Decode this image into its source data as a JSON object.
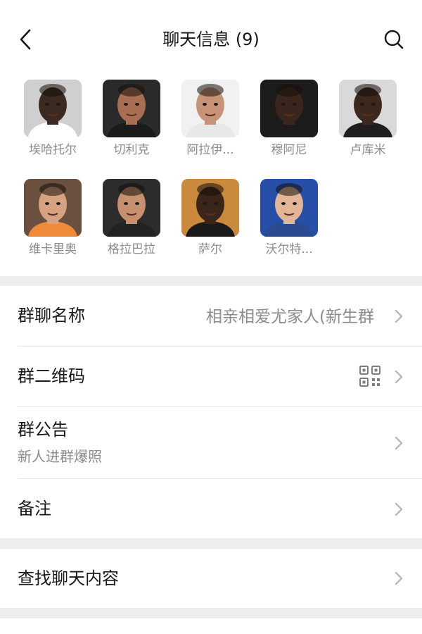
{
  "header": {
    "title": "聊天信息 (9)",
    "back_icon": "chevron-left-icon",
    "search_icon": "search-icon"
  },
  "members": [
    {
      "name": "埃哈托尔",
      "skin": "#3b2a22",
      "bg": "#cfcfcf",
      "shirt": "#ffffff"
    },
    {
      "name": "切利克",
      "skin": "#a86f52",
      "bg": "#2a2a2a",
      "shirt": "#1b1b1b"
    },
    {
      "name": "阿拉伊...",
      "skin": "#c79378",
      "bg": "#f1f1f1",
      "shirt": "#e8e8e8"
    },
    {
      "name": "穆阿尼",
      "skin": "#3a261d",
      "bg": "#1c1c1c",
      "shirt": "#1c1c1c"
    },
    {
      "name": "卢库米",
      "skin": "#3d281e",
      "bg": "#d9d9d9",
      "shirt": "#1e1e1e"
    },
    {
      "name": "维卡里奥",
      "skin": "#d7a27f",
      "bg": "#6b5040",
      "shirt": "#f08a3b"
    },
    {
      "name": "格拉巴拉",
      "skin": "#c68f6d",
      "bg": "#2c2c2c",
      "shirt": "#222222"
    },
    {
      "name": "萨尔",
      "skin": "#3b2519",
      "bg": "#c98a3d",
      "shirt": "#1a1a1a"
    },
    {
      "name": "沃尔特...",
      "skin": "#e3b596",
      "bg": "#274fa8",
      "shirt": "#2b4a8f"
    }
  ],
  "settings": {
    "group_name": {
      "label": "群聊名称",
      "value": "相亲相爱尤家人(新生群"
    },
    "qr_code": {
      "label": "群二维码",
      "icon": "qr-code-icon"
    },
    "announcement": {
      "label": "群公告",
      "content": "新人进群爆照"
    },
    "remark": {
      "label": "备注"
    },
    "search_history": {
      "label": "查找聊天内容"
    }
  },
  "colors": {
    "background": "#ededed",
    "card": "#ffffff",
    "primary_text": "#181818",
    "secondary_text": "#8c8c8c",
    "divider": "#e5e5e5"
  }
}
